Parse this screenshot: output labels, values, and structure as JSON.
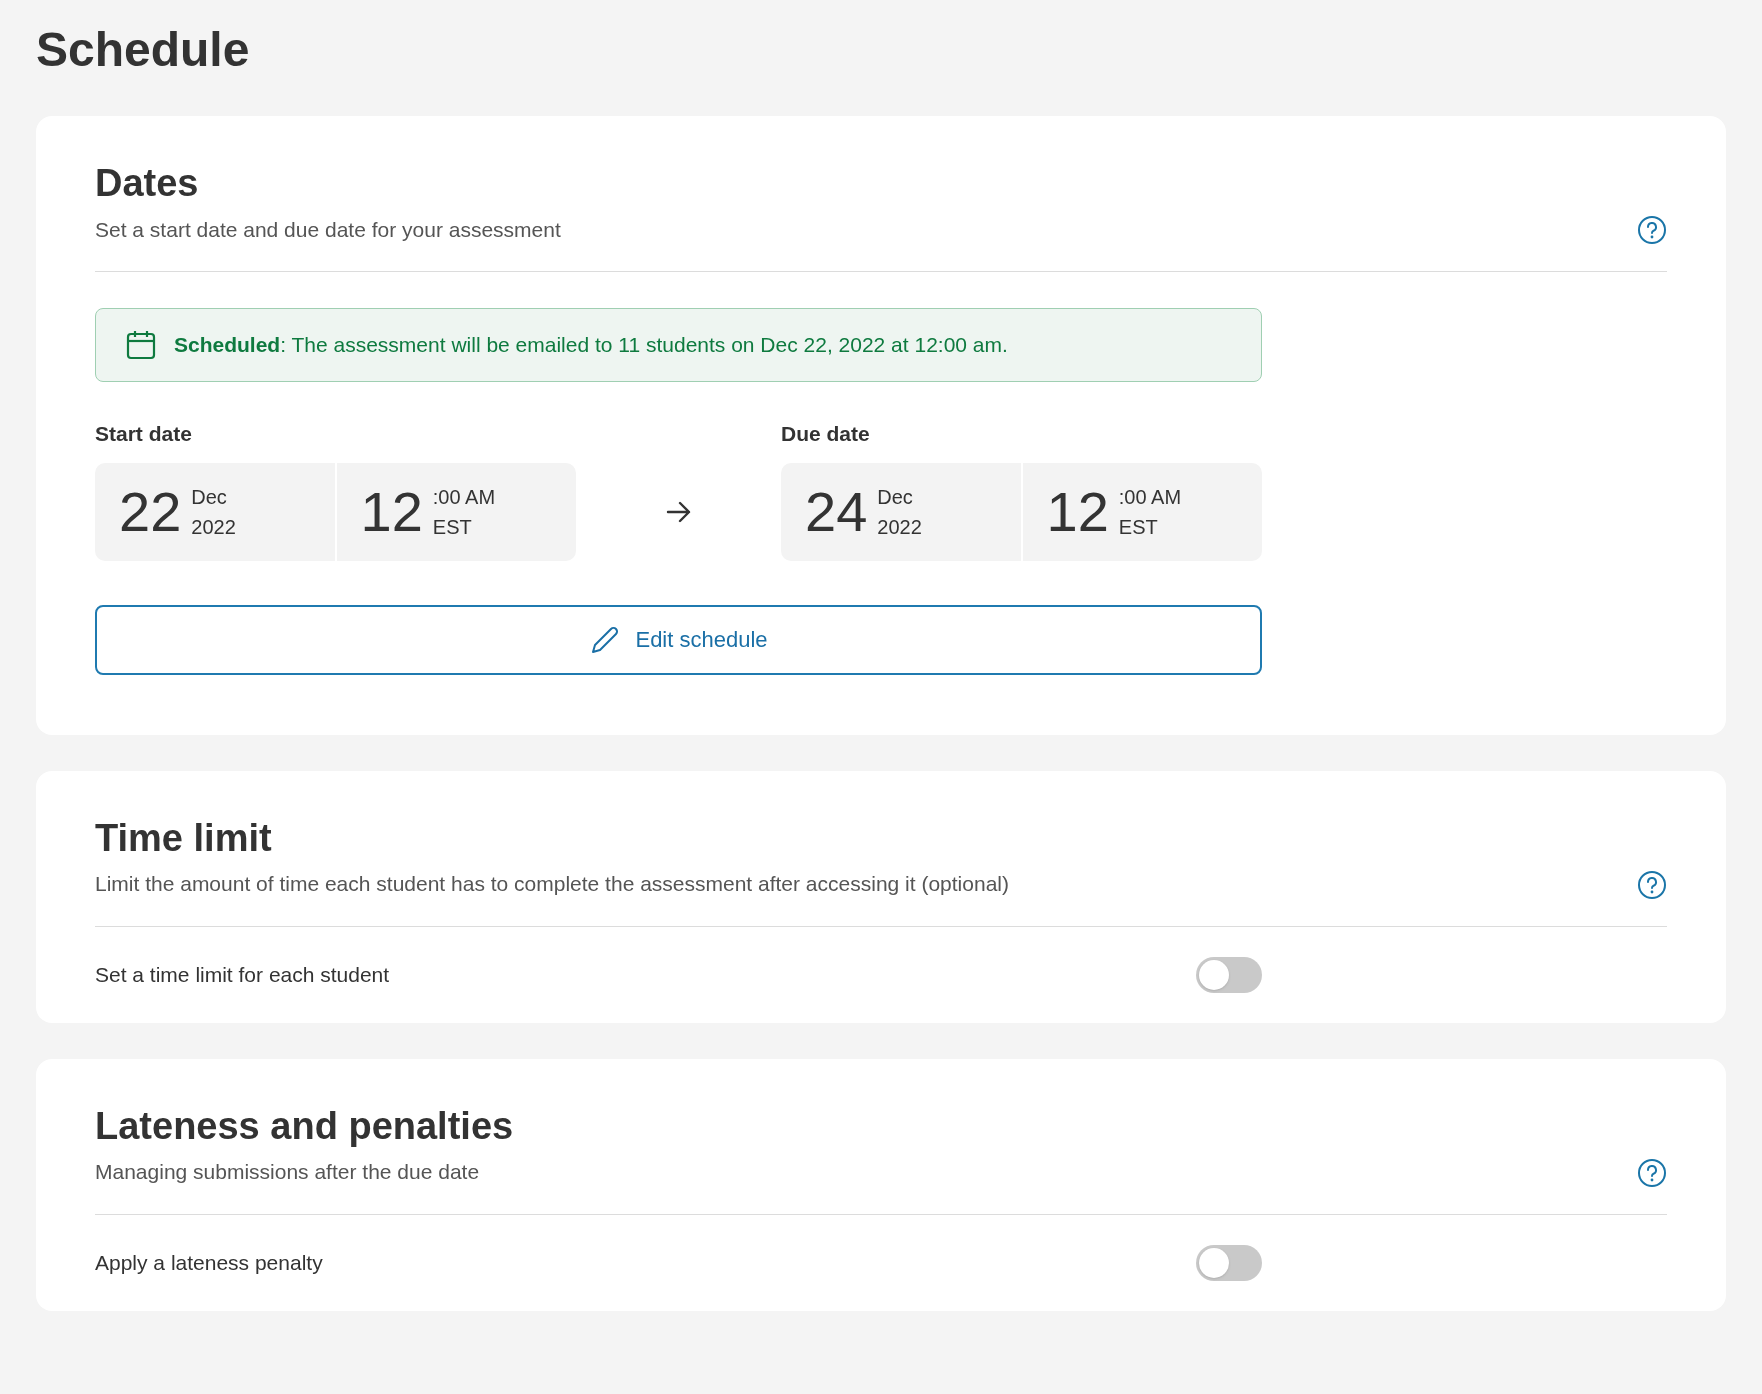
{
  "page_title": "Schedule",
  "sections": [
    {
      "kind": "dates",
      "title": "Dates",
      "description": "Set a start date and due date for your assessment",
      "banner": "**Scheduled**: The assessment will be emailed to 11 students on Dec 22, 2022 at 12:00 am.",
      "start": {
        "label": "Start date",
        "day": "22",
        "month": "Dec",
        "year": "2022",
        "hour": "12",
        "minutes": ":00 AM",
        "zone": "EST"
      },
      "due": {
        "label": "Due date",
        "day": "24",
        "month": "Dec",
        "year": "2022",
        "hour": "12",
        "minutes": ":00 AM",
        "zone": "EST"
      },
      "button": "Edit schedule"
    },
    {
      "kind": "toggle",
      "title": "Time limit",
      "description": "Limit the amount of time each student has to complete the assessment after accessing it (optional)",
      "setting": {
        "label": "Set a time limit for each student",
        "on": false
      }
    },
    {
      "kind": "toggle",
      "title": "Lateness and penalties",
      "description": "Managing submissions after the due date",
      "setting": {
        "label": "Apply a lateness penalty",
        "on": false
      }
    }
  ]
}
